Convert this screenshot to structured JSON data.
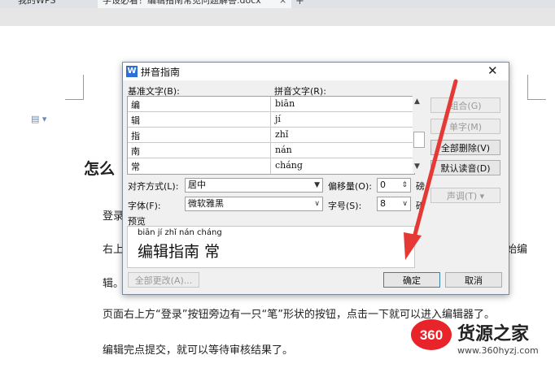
{
  "tabs": {
    "home": "我的WPS",
    "doc": "学设必看！编辑指南常见问题解答.docx",
    "close": "×",
    "add": "+"
  },
  "document": {
    "heading": "怎么",
    "para1": "登录",
    "para2_left": "右上",
    "para2_right": "始编",
    "para3": "辑。",
    "para4": "页面右上方“登录”按钮旁边有一只“笔”形状的按钮，点击一下就可以进入编辑器了。",
    "para5": "编辑完点提交，就可以等待审核结果了。"
  },
  "dialog": {
    "title": "拼音指南",
    "base_header": "基准文字(B):",
    "pinyin_header": "拼音文字(R):",
    "rows": [
      {
        "base": "编",
        "pinyin": "biān"
      },
      {
        "base": "辑",
        "pinyin": "jí"
      },
      {
        "base": "指",
        "pinyin": "zhǐ"
      },
      {
        "base": "南",
        "pinyin": "nán"
      },
      {
        "base": "常",
        "pinyin": "cháng"
      }
    ],
    "buttons": {
      "combine": "组合(G)",
      "single": "单字(M)",
      "clear_all": "全部删除(V)",
      "default_reading": "默认读音(D)",
      "tone": "声调(T)",
      "change_all": "全部更改(A)...",
      "ok": "确定",
      "cancel": "取消"
    },
    "align_label": "对齐方式(L):",
    "align_value": "居中",
    "offset_label": "偏移量(O):",
    "offset_value": "0",
    "offset_unit": "磅",
    "font_label": "字体(F):",
    "font_value": "微软雅黑",
    "size_label": "字号(S):",
    "size_value": "8",
    "size_unit": "磅",
    "preview_label": "预览",
    "preview_pinyin": "biān  jí  zhǐ nán cháng",
    "preview_text": "编辑指南 常"
  },
  "watermark": {
    "logo_number": "360",
    "name": "货源之家",
    "url": "www.360hyzj.com"
  },
  "colors": {
    "accent": "#2d6fd6",
    "arrow": "#e53935",
    "logo_red": "#e8232a"
  }
}
